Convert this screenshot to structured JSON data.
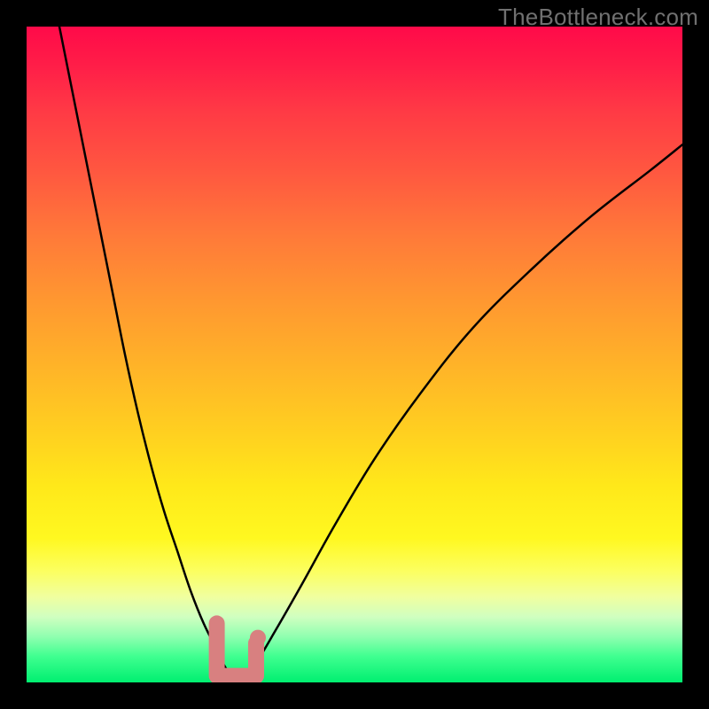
{
  "watermark": "TheBottleneck.com",
  "chart_data": {
    "type": "line",
    "title": "",
    "xlabel": "",
    "ylabel": "",
    "xlim": [
      0,
      100
    ],
    "ylim": [
      0,
      100
    ],
    "grid": false,
    "legend": false,
    "series": [
      {
        "name": "bottleneck-curve",
        "x": [
          5,
          7,
          9,
          11,
          13,
          15,
          17,
          19,
          21,
          23,
          25,
          27,
          29,
          30.5,
          32,
          33.5,
          35,
          38,
          42,
          47,
          53,
          60,
          68,
          77,
          86,
          95,
          100
        ],
        "values": [
          100,
          90,
          80,
          70,
          60,
          50,
          41,
          33,
          26,
          20,
          14,
          9,
          5,
          2,
          1,
          1.5,
          3,
          8,
          15,
          24,
          34,
          44,
          54,
          63,
          71,
          78,
          82
        ]
      }
    ],
    "annotations": [
      {
        "name": "optimal-range-marker",
        "shape": "u-bracket",
        "x_range": [
          29,
          35
        ],
        "y_range": [
          1,
          9
        ],
        "color": "#d88080"
      }
    ],
    "background": {
      "type": "vertical-gradient",
      "stops": [
        {
          "pos": 0,
          "color": "#ff0a49"
        },
        {
          "pos": 50,
          "color": "#ffb428"
        },
        {
          "pos": 78,
          "color": "#fff820"
        },
        {
          "pos": 100,
          "color": "#00ef70"
        }
      ]
    }
  }
}
